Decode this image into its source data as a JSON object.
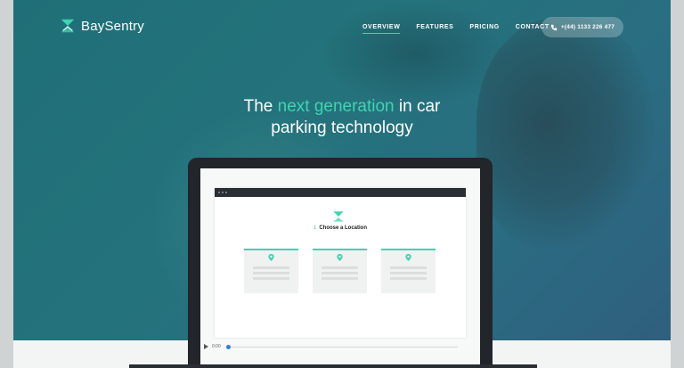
{
  "brand": {
    "name": "BaySentry",
    "logo_icon": "baysentry-logo-icon",
    "accent": "#3fd4b0"
  },
  "nav": {
    "items": [
      {
        "label": "OVERVIEW",
        "active": true
      },
      {
        "label": "FEATURES",
        "active": false
      },
      {
        "label": "PRICING",
        "active": false
      },
      {
        "label": "CONTACT",
        "active": false
      }
    ],
    "phone": {
      "label": "+(44) 1133 226 477",
      "icon": "phone-icon"
    }
  },
  "hero": {
    "headline_pre": "The ",
    "headline_accent": "next generation",
    "headline_post": " in car",
    "headline_line2": "parking technology"
  },
  "demo": {
    "step_number": "1",
    "step_title": "Choose a Location",
    "cards": [
      {
        "icon": "location-pin-icon"
      },
      {
        "icon": "location-pin-icon"
      },
      {
        "icon": "location-pin-icon"
      }
    ],
    "video": {
      "time": "0:00",
      "progress": 0
    }
  },
  "colors": {
    "hero_bg": "#1f6f78",
    "accent": "#3fd4b0",
    "laptop": "#22262b"
  }
}
